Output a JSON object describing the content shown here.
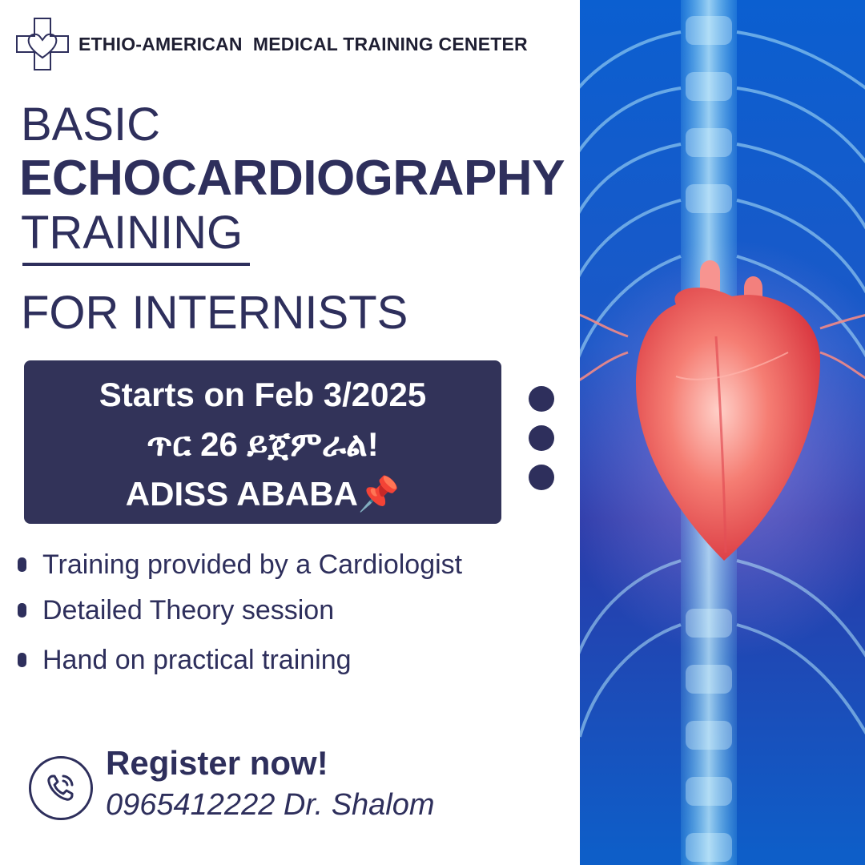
{
  "header": {
    "org_name": "ETHIO-AMERICAN  MEDICAL TRAINING CENETER"
  },
  "headline": {
    "line1": "BASIC",
    "line2": "ECHOCARDIOGRAPHY",
    "line3": "TRAINING",
    "line4": "FOR INTERNISTS"
  },
  "date_box": {
    "line1": "Starts on Feb 3/2025",
    "line2": "ጥር 26 ይጀምራል!",
    "line3": "ADISS ABABA",
    "pin_emoji": "📌"
  },
  "bullets": [
    "Training provided by a Cardiologist",
    "Detailed Theory session",
    "Hand on practical training"
  ],
  "contact": {
    "cta": "Register now!",
    "phone_line": "0965412222 Dr. Shalom"
  },
  "icons": {
    "logo": "medical-cross-heart-icon",
    "phone": "phone-icon",
    "pin": "pushpin-icon"
  },
  "colors": {
    "navy": "#2e2f5c",
    "box": "#323359",
    "xray_blue": "#1a63c9",
    "heart_red": "#f0605e"
  }
}
